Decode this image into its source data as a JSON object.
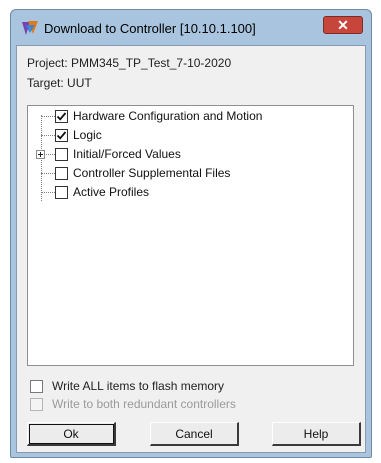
{
  "window": {
    "title": "Download to Controller [10.10.1.100]",
    "icon": "app-icon",
    "close_icon": "close-icon"
  },
  "project": {
    "label": "Project:",
    "value": "PMM345_TP_Test_7-10-2020"
  },
  "target": {
    "label": "Target:",
    "value": "UUT"
  },
  "tree": {
    "items": [
      {
        "label": "Hardware Configuration and Motion",
        "checked": true,
        "expandable": false
      },
      {
        "label": "Logic",
        "checked": true,
        "expandable": false
      },
      {
        "label": "Initial/Forced Values",
        "checked": false,
        "expandable": true
      },
      {
        "label": "Controller Supplemental Files",
        "checked": false,
        "expandable": false
      },
      {
        "label": "Active Profiles",
        "checked": false,
        "expandable": false
      }
    ]
  },
  "options": {
    "flash": {
      "label": "Write ALL items to flash memory",
      "checked": false,
      "enabled": true
    },
    "redundant": {
      "label": "Write to both redundant controllers",
      "checked": false,
      "enabled": false
    }
  },
  "buttons": {
    "ok": "Ok",
    "cancel": "Cancel",
    "help": "Help"
  },
  "colors": {
    "title_bar": "#a9c4de",
    "close_button": "#c7463c",
    "dialog_face": "#f0f0f0"
  }
}
